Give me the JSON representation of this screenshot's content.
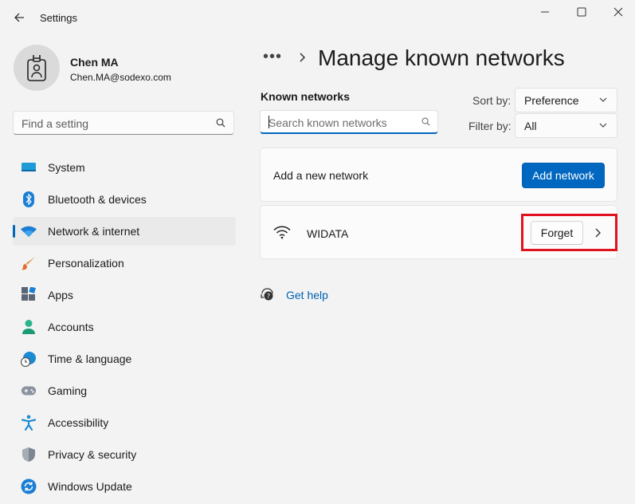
{
  "window": {
    "title": "Settings"
  },
  "profile": {
    "name": "Chen MA",
    "email": "Chen.MA@sodexo.com"
  },
  "search_setting": {
    "placeholder": "Find a setting"
  },
  "nav": [
    {
      "label": "System",
      "icon": "monitor-icon"
    },
    {
      "label": "Bluetooth & devices",
      "icon": "bluetooth-icon"
    },
    {
      "label": "Network & internet",
      "icon": "wifi-icon",
      "active": true
    },
    {
      "label": "Personalization",
      "icon": "brush-icon"
    },
    {
      "label": "Apps",
      "icon": "apps-icon"
    },
    {
      "label": "Accounts",
      "icon": "person-icon"
    },
    {
      "label": "Time & language",
      "icon": "globe-clock-icon"
    },
    {
      "label": "Gaming",
      "icon": "gamepad-icon"
    },
    {
      "label": "Accessibility",
      "icon": "accessibility-icon"
    },
    {
      "label": "Privacy & security",
      "icon": "shield-icon"
    },
    {
      "label": "Windows Update",
      "icon": "update-icon"
    }
  ],
  "main": {
    "breadcrumb_dots": "•••",
    "title": "Manage known networks",
    "known_networks_label": "Known networks",
    "search_placeholder": "Search known networks",
    "sort": {
      "label": "Sort by:",
      "value": "Preference"
    },
    "filter": {
      "label": "Filter by:",
      "value": "All"
    },
    "add_card": {
      "label": "Add a new network",
      "button": "Add network"
    },
    "networks": [
      {
        "ssid": "WIDATA",
        "forget_label": "Forget"
      }
    ],
    "help_link": "Get help"
  },
  "colors": {
    "accent": "#0067c0",
    "highlight": "#e0121e"
  }
}
